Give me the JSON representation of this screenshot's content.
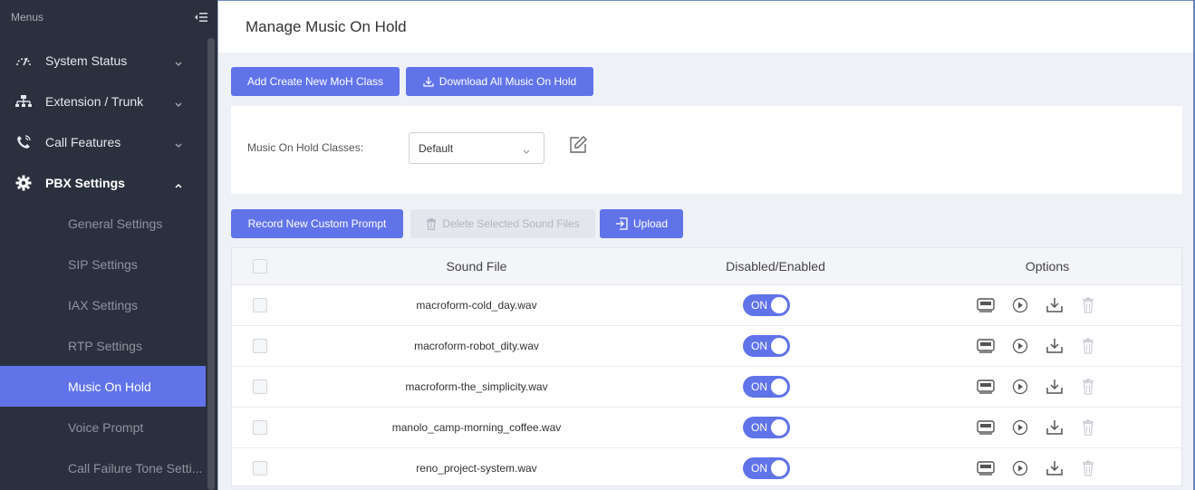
{
  "sidebar": {
    "header_label": "Menus",
    "menu": [
      {
        "label": "System Status",
        "icon": "gauge-icon"
      },
      {
        "label": "Extension / Trunk",
        "icon": "network-icon"
      },
      {
        "label": "Call Features",
        "icon": "phone-icon"
      },
      {
        "label": "PBX Settings",
        "icon": "gear-icon"
      }
    ],
    "sub_items": [
      {
        "label": "General Settings"
      },
      {
        "label": "SIP Settings"
      },
      {
        "label": "IAX Settings"
      },
      {
        "label": "RTP Settings"
      },
      {
        "label": "Music On Hold"
      },
      {
        "label": "Voice Prompt"
      },
      {
        "label": "Call Failure Tone Setti..."
      }
    ],
    "active_sub": "Music On Hold"
  },
  "page": {
    "title": "Manage Music On Hold"
  },
  "toolbar": {
    "add_class_label": "Add Create New MoH Class",
    "download_all_label": "Download All Music On Hold"
  },
  "class_panel": {
    "label": "Music On Hold Classes:",
    "selected": "Default"
  },
  "file_toolbar": {
    "record_label": "Record New Custom Prompt",
    "delete_label": "Delete Selected Sound Files",
    "upload_label": "Upload"
  },
  "table": {
    "headers": {
      "file": "Sound File",
      "enabled": "Disabled/Enabled",
      "options": "Options"
    },
    "rows": [
      {
        "file": "macroform-cold_day.wav",
        "state": "ON"
      },
      {
        "file": "macroform-robot_dity.wav",
        "state": "ON"
      },
      {
        "file": "macroform-the_simplicity.wav",
        "state": "ON"
      },
      {
        "file": "manolo_camp-morning_coffee.wav",
        "state": "ON"
      },
      {
        "file": "reno_project-system.wav",
        "state": "ON"
      }
    ]
  },
  "colors": {
    "accent": "#6173e9",
    "sidebar_bg": "#2b303e"
  }
}
